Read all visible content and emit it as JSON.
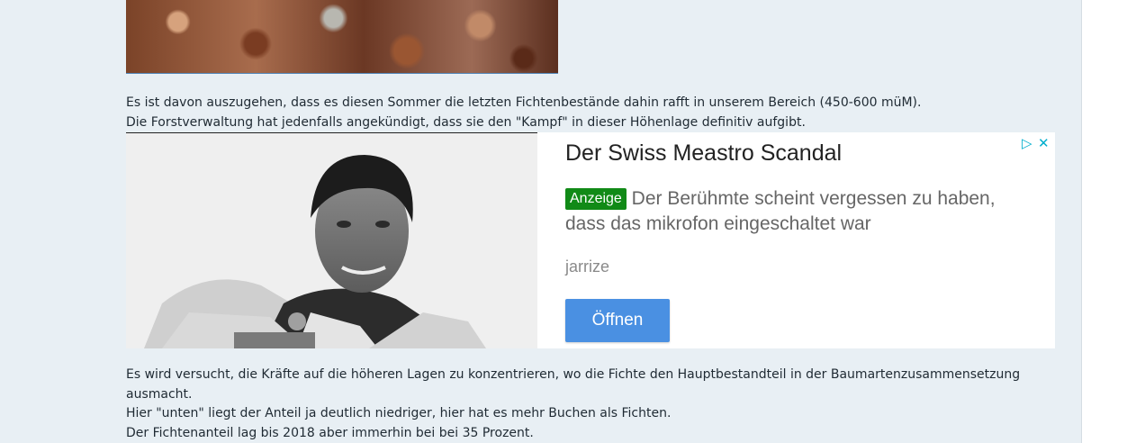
{
  "article": {
    "paragraph1_line1": "Es ist davon auszugehen, dass es diesen Sommer die letzten Fichtenbestände dahin rafft in unserem Bereich (450-600 müM).",
    "paragraph1_line2": "Die Forstverwaltung hat jedenfalls angekündigt, dass sie den \"Kampf\" in dieser Höhenlage definitiv aufgibt.",
    "paragraph2_line1": "Es wird versucht, die Kräfte auf die höheren Lagen zu konzentrieren, wo die Fichte den Hauptbestandteil in der Baumartenzusammensetzung ausmacht.",
    "paragraph2_line2": "Hier \"unten\" liegt der Anteil ja deutlich niedriger, hier hat es mehr Buchen als Fichten.",
    "paragraph2_line3": "Der Fichtenanteil lag bis 2018 aber immerhin bei bei 35 Prozent."
  },
  "ad": {
    "title": "Der Swiss Meastro Scandal",
    "badge": "Anzeige",
    "text": "Der Berühmte scheint vergessen zu haben, dass das mikrofon eingeschaltet war",
    "source": "jarrize",
    "button_label": "Öffnen",
    "choices_icon": "▷",
    "close_icon": "✕"
  },
  "colors": {
    "page_background": "#e8eff4",
    "ad_badge": "#118a17",
    "ad_button": "#4a90e2",
    "ad_choices": "#00aecd"
  }
}
